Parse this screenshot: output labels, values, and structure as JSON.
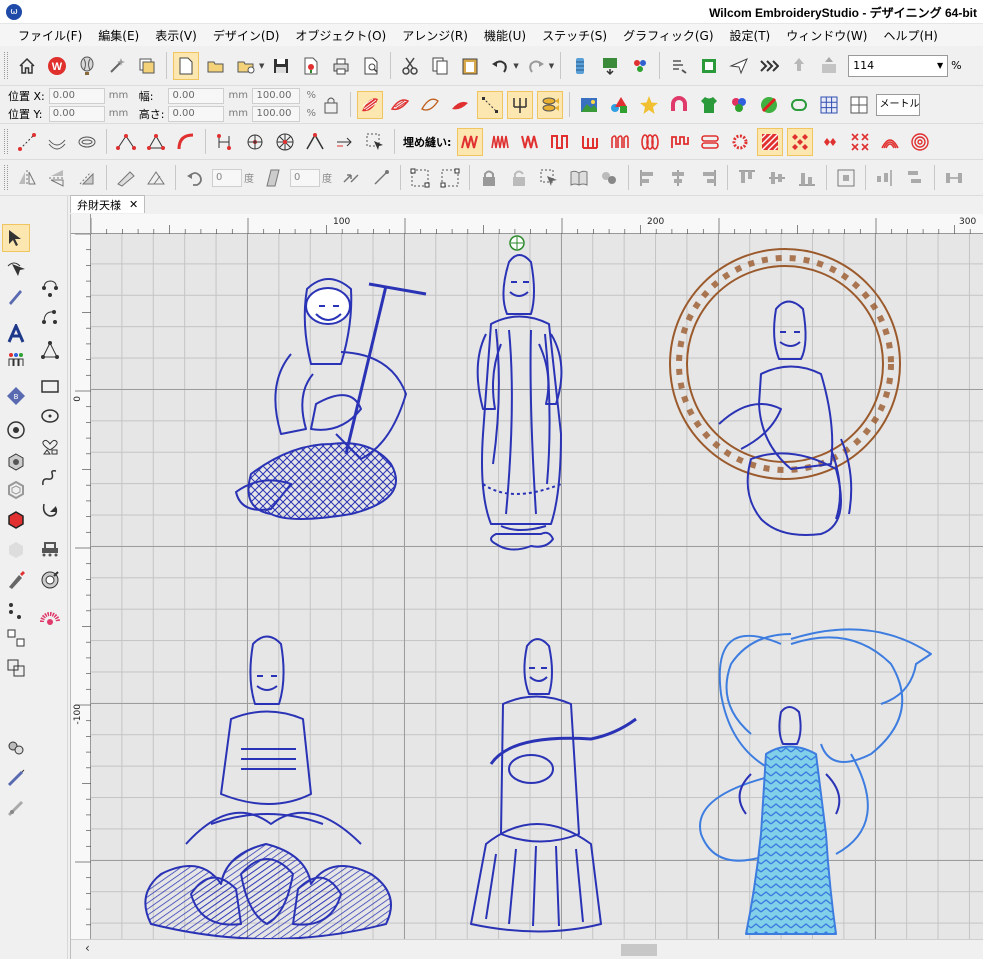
{
  "app": {
    "title": "Wilcom EmbroideryStudio - デザイニング 64-bit",
    "logo_glyph": "ω"
  },
  "menu": {
    "items": [
      "ファイル(F)",
      "編集(E)",
      "表示(V)",
      "デザイン(D)",
      "オブジェクト(O)",
      "アレンジ(R)",
      "機能(U)",
      "ステッチ(S)",
      "グラフィック(G)",
      "設定(T)",
      "ウィンドウ(W)",
      "ヘルプ(H)"
    ]
  },
  "toolbar1": {
    "zoom_value": "114",
    "zoom_suffix": "%"
  },
  "props": {
    "pos_x_label": "位置 X:",
    "pos_x_value": "0.00",
    "pos_y_label": "位置 Y:",
    "pos_y_value": "0.00",
    "width_label": "幅:",
    "width_value": "0.00",
    "height_label": "高さ:",
    "height_value": "0.00",
    "unit": "mm",
    "scale_w": "100.00",
    "scale_h": "100.00",
    "percent": "%",
    "units_combo": "メートル法"
  },
  "fill_bar": {
    "label": "埋め縫い:"
  },
  "transform_bar": {
    "angle1": "0",
    "angle2": "0",
    "deg_label": "度"
  },
  "document": {
    "tab_title": "弁財天様",
    "close_glyph": "✕"
  },
  "rulers": {
    "top": [
      "100",
      "200",
      "300"
    ],
    "left": [
      "0",
      "-100"
    ]
  },
  "colors": {
    "design_blue": "#2a33b5",
    "design_light_blue": "#3e7de0",
    "halo_brown": "#9b5a2c",
    "accent_red": "#e03030",
    "selected_tool": "#fde7b0"
  }
}
